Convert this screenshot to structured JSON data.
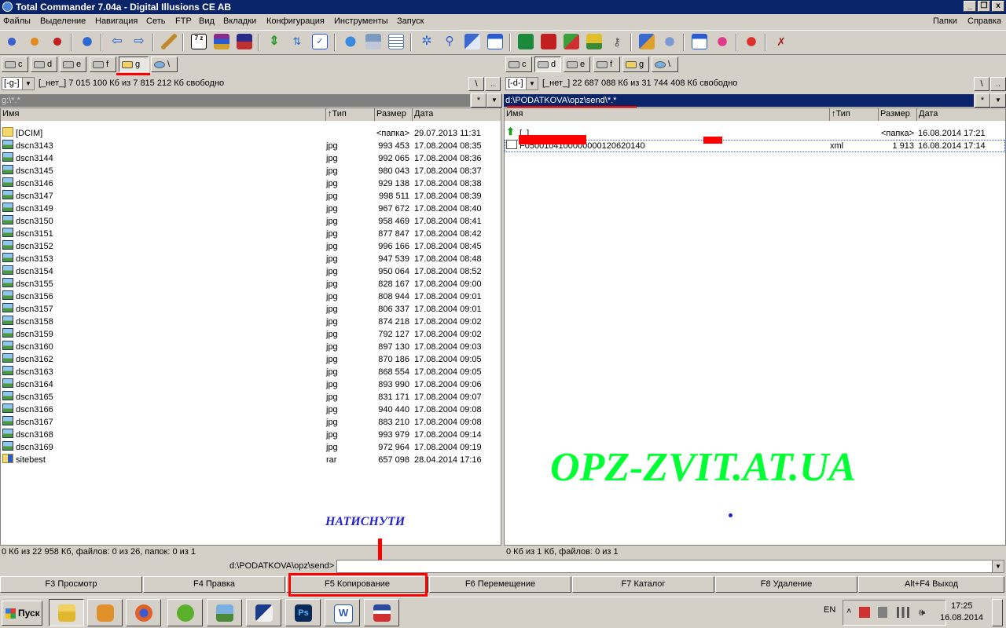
{
  "window": {
    "title": "Total Commander 7.04a - Digital Illusions CE AB",
    "btn_min": "_",
    "btn_max": "ф",
    "btn_close": "x"
  },
  "menu": {
    "files": "Файлы",
    "selection": "Выделение",
    "navigation": "Навигация",
    "network": "Сеть",
    "ftp": "FTP",
    "view": "Вид",
    "tabs": "Вкладки",
    "config": "Конфигурация",
    "tools": "Инструменты",
    "launch": "Запуск",
    "folders": "Папки",
    "help": "Справка"
  },
  "toolbar": {
    "icons": [
      "gear-icon",
      "gear2-icon",
      "gear3-icon",
      "refresh-icon",
      "back-icon",
      "forward-icon",
      "wrench-icon",
      "7z-icon",
      "winrar-icon",
      "archive-icon",
      "sync-icon",
      "sort-icon",
      "checklist-icon",
      "ie-icon",
      "settings-icon",
      "grid-icon",
      "star-icon",
      "search-icon",
      "copy-icon",
      "calendar-icon",
      "book-icon",
      "save-icon",
      "photos-icon",
      "camera-icon",
      "key-icon",
      "puzzle-icon",
      "inspect-icon",
      "window-icon",
      "flower-icon",
      "recycle-icon",
      "tools-icon"
    ],
    "label_7z": "7 z"
  },
  "left": {
    "drives": [
      "c",
      "d",
      "e",
      "f",
      "g",
      "\\"
    ],
    "active_drive": "g",
    "drive_combo": "[-g-]",
    "drive_free": "[_нет_]  7 015 100 Кб из 7 815 212 Кб свободно",
    "path": "g:\\*.*",
    "columns": {
      "name": "Имя",
      "type": "↑Тип",
      "size": "Размер",
      "date": "Дата"
    },
    "rows": [
      {
        "name": "[DCIM]",
        "type": "",
        "size": "<папка>",
        "date": "29.07.2013 11:31",
        "icon": "folder"
      },
      {
        "name": "dscn3143",
        "type": "jpg",
        "size": "993 453",
        "date": "17.08.2004 08:35",
        "icon": "image"
      },
      {
        "name": "dscn3144",
        "type": "jpg",
        "size": "992 065",
        "date": "17.08.2004 08:36",
        "icon": "image"
      },
      {
        "name": "dscn3145",
        "type": "jpg",
        "size": "980 043",
        "date": "17.08.2004 08:37",
        "icon": "image"
      },
      {
        "name": "dscn3146",
        "type": "jpg",
        "size": "929 138",
        "date": "17.08.2004 08:38",
        "icon": "image"
      },
      {
        "name": "dscn3147",
        "type": "jpg",
        "size": "998 511",
        "date": "17.08.2004 08:39",
        "icon": "image"
      },
      {
        "name": "dscn3149",
        "type": "jpg",
        "size": "967 672",
        "date": "17.08.2004 08:40",
        "icon": "image"
      },
      {
        "name": "dscn3150",
        "type": "jpg",
        "size": "958 469",
        "date": "17.08.2004 08:41",
        "icon": "image"
      },
      {
        "name": "dscn3151",
        "type": "jpg",
        "size": "877 847",
        "date": "17.08.2004 08:42",
        "icon": "image"
      },
      {
        "name": "dscn3152",
        "type": "jpg",
        "size": "996 166",
        "date": "17.08.2004 08:45",
        "icon": "image"
      },
      {
        "name": "dscn3153",
        "type": "jpg",
        "size": "947 539",
        "date": "17.08.2004 08:48",
        "icon": "image"
      },
      {
        "name": "dscn3154",
        "type": "jpg",
        "size": "950 064",
        "date": "17.08.2004 08:52",
        "icon": "image"
      },
      {
        "name": "dscn3155",
        "type": "jpg",
        "size": "828 167",
        "date": "17.08.2004 09:00",
        "icon": "image"
      },
      {
        "name": "dscn3156",
        "type": "jpg",
        "size": "808 944",
        "date": "17.08.2004 09:01",
        "icon": "image"
      },
      {
        "name": "dscn3157",
        "type": "jpg",
        "size": "806 337",
        "date": "17.08.2004 09:01",
        "icon": "image"
      },
      {
        "name": "dscn3158",
        "type": "jpg",
        "size": "874 218",
        "date": "17.08.2004 09:02",
        "icon": "image"
      },
      {
        "name": "dscn3159",
        "type": "jpg",
        "size": "792 127",
        "date": "17.08.2004 09:02",
        "icon": "image"
      },
      {
        "name": "dscn3160",
        "type": "jpg",
        "size": "897 130",
        "date": "17.08.2004 09:03",
        "icon": "image"
      },
      {
        "name": "dscn3162",
        "type": "jpg",
        "size": "870 186",
        "date": "17.08.2004 09:05",
        "icon": "image"
      },
      {
        "name": "dscn3163",
        "type": "jpg",
        "size": "868 554",
        "date": "17.08.2004 09:05",
        "icon": "image"
      },
      {
        "name": "dscn3164",
        "type": "jpg",
        "size": "893 990",
        "date": "17.08.2004 09:06",
        "icon": "image"
      },
      {
        "name": "dscn3165",
        "type": "jpg",
        "size": "831 171",
        "date": "17.08.2004 09:07",
        "icon": "image"
      },
      {
        "name": "dscn3166",
        "type": "jpg",
        "size": "940 440",
        "date": "17.08.2004 09:08",
        "icon": "image"
      },
      {
        "name": "dscn3167",
        "type": "jpg",
        "size": "883 210",
        "date": "17.08.2004 09:08",
        "icon": "image"
      },
      {
        "name": "dscn3168",
        "type": "jpg",
        "size": "993 979",
        "date": "17.08.2004 09:14",
        "icon": "image"
      },
      {
        "name": "dscn3169",
        "type": "jpg",
        "size": "972 964",
        "date": "17.08.2004 09:19",
        "icon": "image"
      },
      {
        "name": "sitebest",
        "type": "rar",
        "size": "657 098",
        "date": "28.04.2014 17:16",
        "icon": "archive"
      }
    ],
    "status": "0 Кб из 22 958 Кб, файлов: 0 из 26, папок: 0 из 1"
  },
  "right": {
    "drives": [
      "c",
      "d",
      "e",
      "f",
      "g",
      "\\"
    ],
    "active_drive": "d",
    "drive_combo": "[-d-]",
    "drive_free": "[_нет_]  22 687 088 Кб из 31 744 408 Кб свободно",
    "path": "d:\\PODATKOVA\\opz\\send\\*.*",
    "columns": {
      "name": "Имя",
      "type": "↑Тип",
      "size": "Размер",
      "date": "Дата"
    },
    "rows": [
      {
        "name": "[..]",
        "type": "",
        "size": "<папка>",
        "date": "16.08.2014 17:21",
        "icon": "up"
      },
      {
        "name": "F0500104100000000120620140",
        "type": "xml",
        "size": "1 913",
        "date": "16.08.2014 17:14",
        "icon": "xml"
      }
    ],
    "status": "0 Кб из 1 Кб, файлов: 0 из 1"
  },
  "command_line": {
    "prompt": "d:\\PODATKOVA\\opz\\send>",
    "value": ""
  },
  "common": {
    "root_btn": "\\",
    "up_btn": "..",
    "star_btn": "*",
    "arrow_btn": "▼"
  },
  "fkeys": [
    "F3 Просмотр",
    "F4 Правка",
    "F5 Копирование",
    "F6 Перемещение",
    "F7 Каталог",
    "F8 Удаление",
    "Alt+F4 Выход"
  ],
  "overlay": {
    "watermark": "OPZ-ZVIT.AT.UA",
    "annotation": "НАТИСНУТИ",
    "highlight_color": "#ff0000"
  },
  "taskbar": {
    "start": "Пуск",
    "apps": [
      "explorer-icon",
      "media-player-icon",
      "firefox-icon",
      "utorrent-icon",
      "photo-viewer-icon",
      "total-commander-icon",
      "photoshop-icon",
      "word-icon",
      "floppy-icon"
    ],
    "lang": "EN",
    "time": "17:25",
    "date": "16.08.2014"
  }
}
